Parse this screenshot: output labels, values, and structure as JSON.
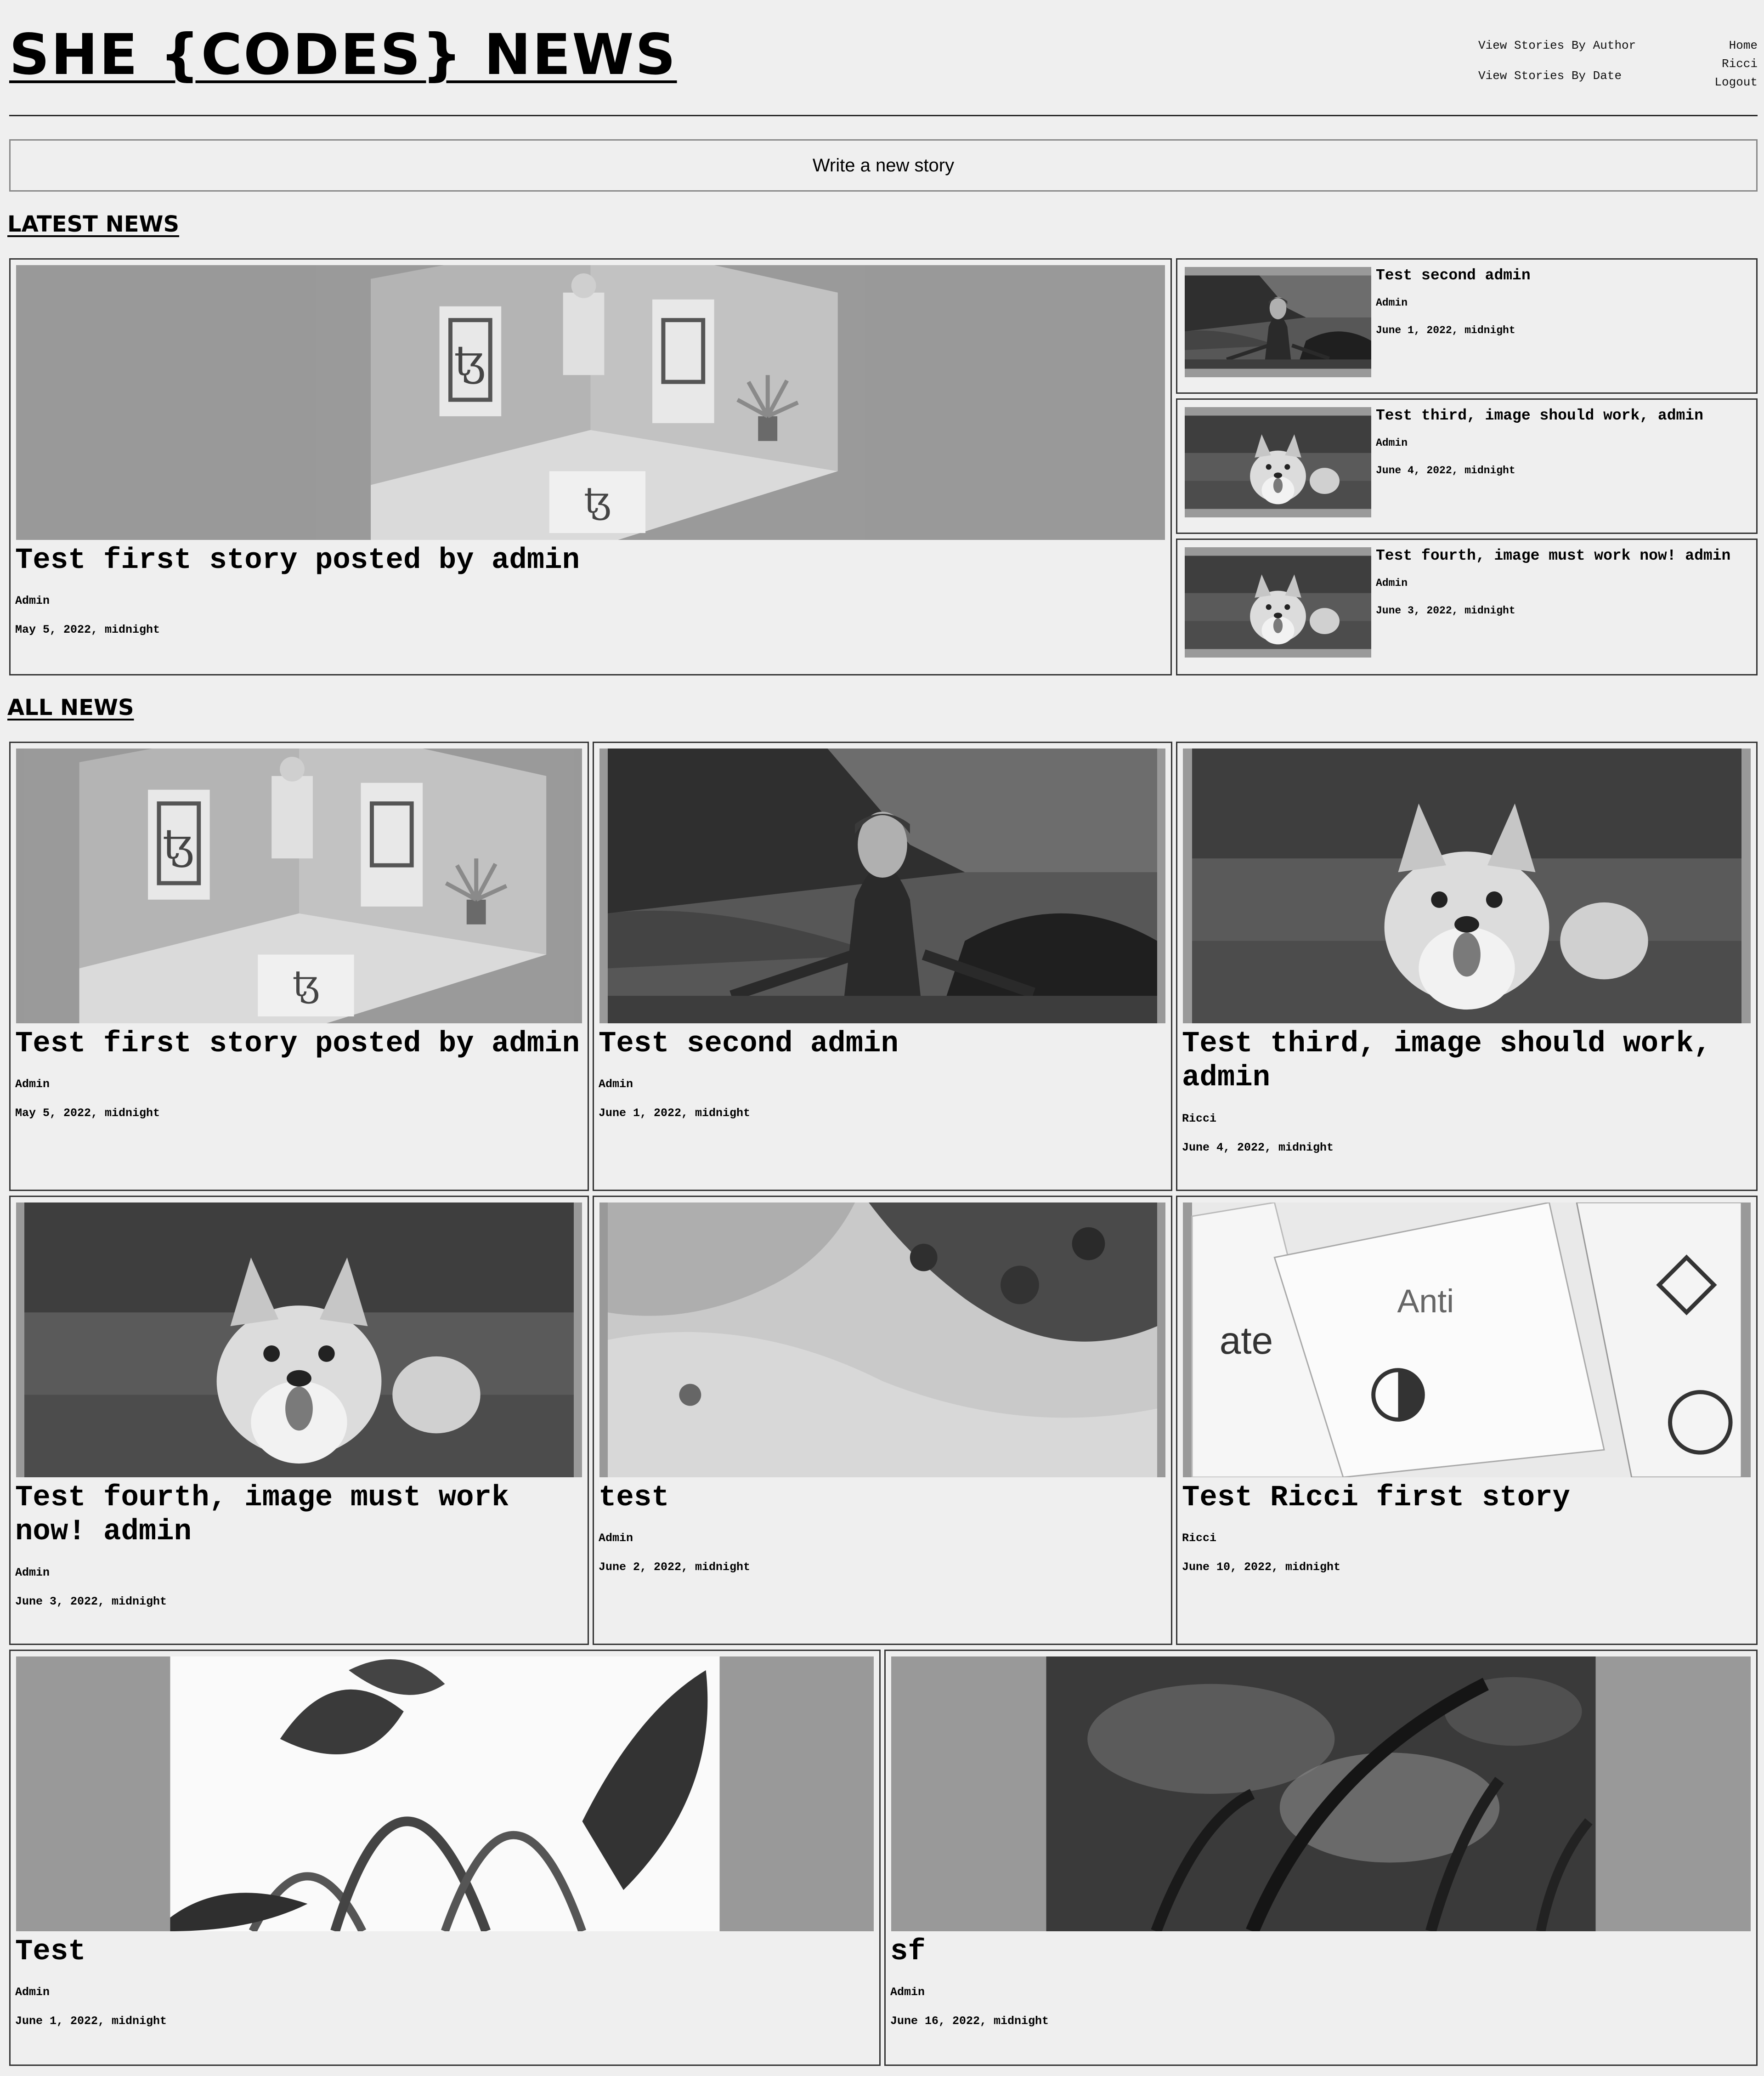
{
  "header": {
    "title": "SHE {CODES} NEWS",
    "nav_author": "View Stories By Author",
    "nav_date": "View Stories By Date",
    "nav_home": "Home",
    "nav_user": "Ricci",
    "nav_logout": "Logout"
  },
  "write_button": "Write a new story",
  "latest": {
    "heading": "LATEST NEWS",
    "featured": {
      "title": "Test first story posted by admin",
      "author": "Admin",
      "date": "May 5, 2022, midnight",
      "image": "gallery-room-image"
    },
    "side": [
      {
        "title": "Test second admin",
        "author": "Admin",
        "date": "June 1, 2022, midnight",
        "image": "woman-coast-image"
      },
      {
        "title": "Test third, image should work, admin",
        "author": "Admin",
        "date": "June 4, 2022, midnight",
        "image": "corgi-image"
      },
      {
        "title": "Test fourth, image must work now! admin",
        "author": "Admin",
        "date": "June 3, 2022, midnight",
        "image": "corgi-image"
      }
    ]
  },
  "all": {
    "heading": "ALL NEWS",
    "stories": [
      {
        "title": "Test first story posted by admin",
        "author": "Admin",
        "date": "May 5, 2022, midnight",
        "image": "gallery-room-image"
      },
      {
        "title": "Test second admin",
        "author": "Admin",
        "date": "June 1, 2022, midnight",
        "image": "woman-coast-image"
      },
      {
        "title": "Test third, image should work, admin",
        "author": "Ricci",
        "date": "June 4, 2022, midnight",
        "image": "corgi-image"
      },
      {
        "title": "Test fourth, image must work now! admin",
        "author": "Admin",
        "date": "June 3, 2022, midnight",
        "image": "corgi-image"
      },
      {
        "title": "test",
        "author": "Admin",
        "date": "June 2, 2022, midnight",
        "image": "aerial-beach-image"
      },
      {
        "title": "Test Ricci first story",
        "author": "Ricci",
        "date": "June 10, 2022, midnight",
        "image": "magazines-image"
      },
      {
        "title": "Test",
        "author": "Admin",
        "date": "June 1, 2022, midnight",
        "image": "plant-leaves-image"
      },
      {
        "title": "sf",
        "author": "Admin",
        "date": "June 16, 2022, midnight",
        "image": "grass-bokeh-image"
      }
    ]
  }
}
